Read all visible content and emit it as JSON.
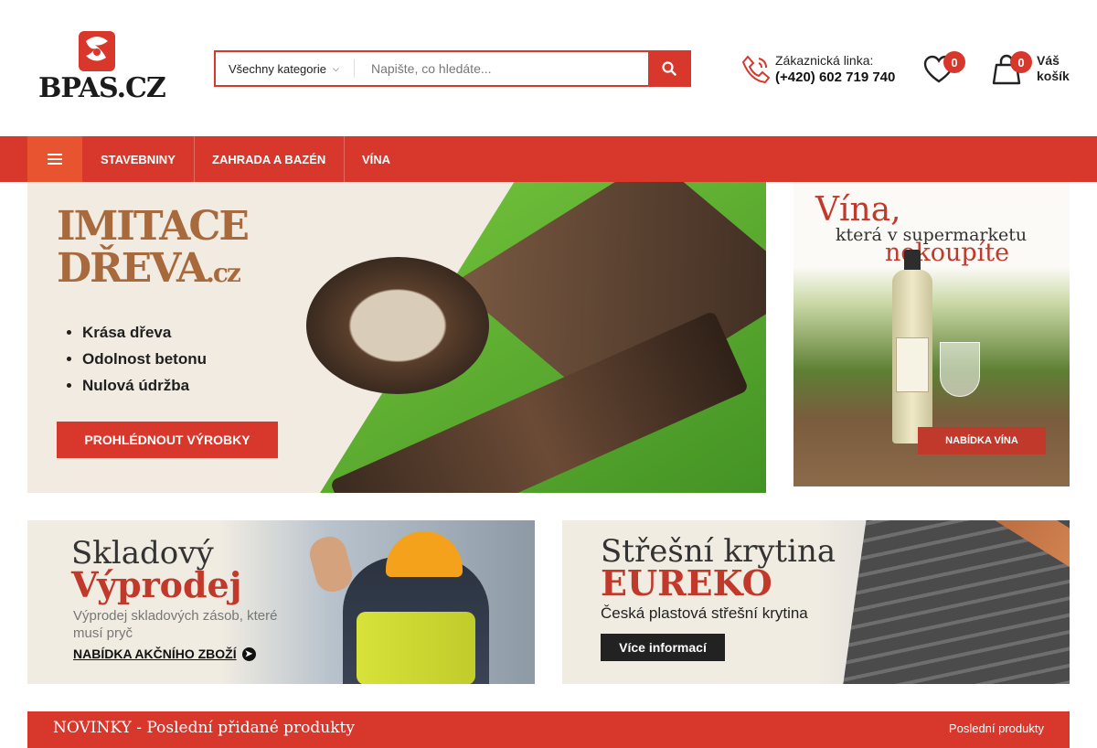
{
  "header": {
    "logo_text": "BPAS.CZ",
    "search": {
      "category_label": "Všechny kategorie",
      "placeholder": "Napište, co hledáte..."
    },
    "phone": {
      "label": "Zákaznická linka:",
      "number": "(+420) 602 719 740"
    },
    "wishlist_count": "0",
    "cart": {
      "count": "0",
      "label": "Váš košík"
    }
  },
  "nav": {
    "items": [
      {
        "label": "STAVEBNINY"
      },
      {
        "label": "ZAHRADA A BAZÉN"
      },
      {
        "label": "VÍNA"
      }
    ]
  },
  "hero": {
    "logo_line1": "IMITACE",
    "logo_line2": "DŘEVA",
    "logo_suffix": ".cz",
    "bullets": [
      "Krása dřeva",
      "Odolnost betonu",
      "Nulová údržba"
    ],
    "button": "PROHLÉDNOUT VÝROBKY"
  },
  "wine_banner": {
    "line1": "Vína,",
    "line2": "která v supermarketu",
    "line3": "nekoupíte",
    "button": "NABÍDKA VÍNA"
  },
  "promo_sale": {
    "title1": "Skladový",
    "title2": "Výprodej",
    "description": "Výprodej skladových zásob, které musí pryč",
    "link": "NABÍDKA AKČNÍHO ZBOŽÍ"
  },
  "promo_roof": {
    "title1": "Střešní krytina",
    "title2": "EUREKO",
    "description": "Česká plastová střešní krytina",
    "button": "Více informací"
  },
  "novinky": {
    "title": "NOVINKY - Poslední přidané produkty",
    "link": "Poslední produkty"
  },
  "colors": {
    "brand_red": "#d8372b",
    "accent_orange": "#e8542f"
  }
}
